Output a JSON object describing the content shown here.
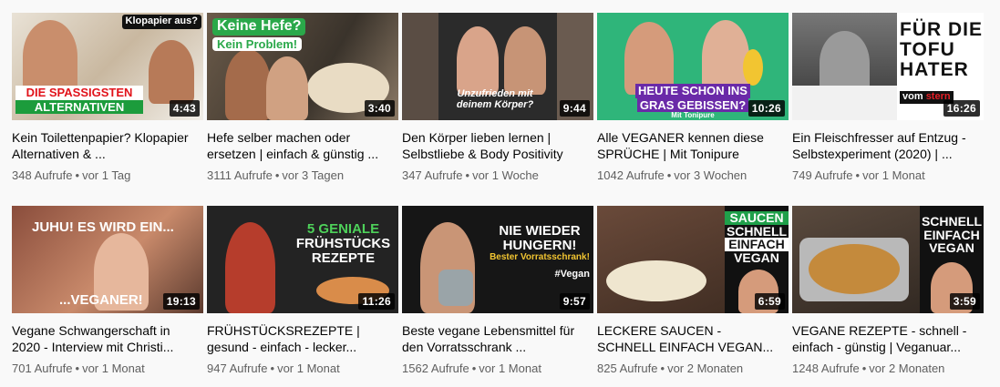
{
  "videos": [
    {
      "title": "Kein Toilettenpapier? Klopapier Alternativen & ...",
      "views": "348 Aufrufe",
      "age": "vor 1 Tag",
      "duration": "4:43",
      "overlay": [
        "DIE SPASSIGSTEN",
        "ALTERNATIVEN",
        "Klopapier aus?"
      ]
    },
    {
      "title": "Hefe selber machen oder ersetzen | einfach & günstig ...",
      "views": "3111 Aufrufe",
      "age": "vor 3 Tagen",
      "duration": "3:40",
      "overlay": [
        "Keine Hefe?",
        "Kein Problem!"
      ]
    },
    {
      "title": "Den Körper lieben lernen | Selbstliebe & Body Positivity",
      "views": "347 Aufrufe",
      "age": "vor 1 Woche",
      "duration": "9:44",
      "overlay": [
        "Unzufrieden mit",
        "deinem Körper?"
      ]
    },
    {
      "title": "Alle VEGANER kennen diese SPRÜCHE | Mit Tonipure",
      "views": "1042 Aufrufe",
      "age": "vor 3 Wochen",
      "duration": "10:26",
      "overlay": [
        "HEUTE SCHON INS",
        "GRAS GEBISSEN?",
        "Mit Tonipure"
      ]
    },
    {
      "title": "Ein Fleischfresser auf Entzug - Selbstexperiment (2020) | ...",
      "views": "749 Aufrufe",
      "age": "vor 1 Monat",
      "duration": "16:26",
      "overlay": [
        "FÜR DIE",
        "TOFU",
        "HATER",
        "vom",
        "stern"
      ]
    },
    {
      "title": "Vegane Schwangerschaft in 2020 - Interview mit Christi...",
      "views": "701 Aufrufe",
      "age": "vor 1 Monat",
      "duration": "19:13",
      "overlay": [
        "JUHU! ES WIRD EIN...",
        "...VEGANER!"
      ]
    },
    {
      "title": "FRÜHSTÜCKSREZEPTE | gesund - einfach - lecker...",
      "views": "947 Aufrufe",
      "age": "vor 1 Monat",
      "duration": "11:26",
      "overlay": [
        "5 GENIALE",
        "FRÜHSTÜCKS",
        "REZEPTE"
      ]
    },
    {
      "title": "Beste vegane Lebensmittel für den Vorratsschrank ...",
      "views": "1562 Aufrufe",
      "age": "vor 1 Monat",
      "duration": "9:57",
      "overlay": [
        "NIE WIEDER",
        "HUNGERN!",
        "Bester Vorratsschrank!",
        "#Vegan"
      ]
    },
    {
      "title": "LECKERE SAUCEN - SCHNELL EINFACH VEGAN...",
      "views": "825 Aufrufe",
      "age": "vor 2 Monaten",
      "duration": "6:59",
      "overlay": [
        "SAUCEN",
        "SCHNELL",
        "EINFACH",
        "VEGAN"
      ]
    },
    {
      "title": "VEGANE REZEPTE - schnell - einfach - günstig | Veganuar...",
      "views": "1248 Aufrufe",
      "age": "vor 2 Monaten",
      "duration": "3:59",
      "overlay": [
        "SCHNELL",
        "EINFACH",
        "VEGAN"
      ]
    }
  ],
  "separator": "•"
}
